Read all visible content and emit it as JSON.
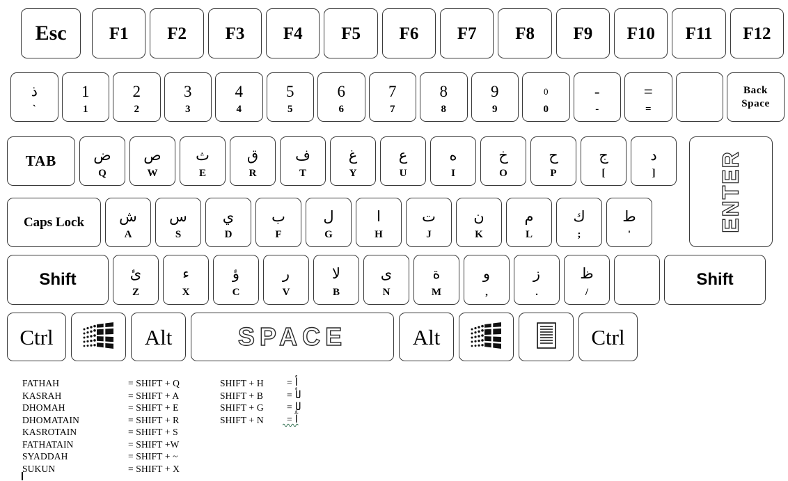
{
  "title": "Arabic Keyboard Layout",
  "rows": {
    "function_row": [
      {
        "label": "Esc",
        "name": "key-esc"
      },
      {
        "label": "F1",
        "name": "key-f1"
      },
      {
        "label": "F2",
        "name": "key-f2"
      },
      {
        "label": "F3",
        "name": "key-f3"
      },
      {
        "label": "F4",
        "name": "key-f4"
      },
      {
        "label": "F5",
        "name": "key-f5"
      },
      {
        "label": "F6",
        "name": "key-f6"
      },
      {
        "label": "F7",
        "name": "key-f7"
      },
      {
        "label": "F8",
        "name": "key-f8"
      },
      {
        "label": "F9",
        "name": "key-f9"
      },
      {
        "label": "F10",
        "name": "key-f10"
      },
      {
        "label": "F11",
        "name": "key-f11"
      },
      {
        "label": "F12",
        "name": "key-f12"
      }
    ],
    "number_row": [
      {
        "arabic": "ذ",
        "latin": "`",
        "name": "key-grave"
      },
      {
        "arabic": "1",
        "latin": "1",
        "name": "key-1"
      },
      {
        "arabic": "2",
        "latin": "2",
        "name": "key-2"
      },
      {
        "arabic": "3",
        "latin": "3",
        "name": "key-3"
      },
      {
        "arabic": "4",
        "latin": "4",
        "name": "key-4"
      },
      {
        "arabic": "5",
        "latin": "5",
        "name": "key-5"
      },
      {
        "arabic": "6",
        "latin": "6",
        "name": "key-6"
      },
      {
        "arabic": "7",
        "latin": "7",
        "name": "key-7"
      },
      {
        "arabic": "8",
        "latin": "8",
        "name": "key-8"
      },
      {
        "arabic": "9",
        "latin": "9",
        "name": "key-9"
      },
      {
        "arabic": "0",
        "latin": "0",
        "name": "key-0"
      },
      {
        "arabic": "-",
        "latin": "-",
        "name": "key-minus"
      },
      {
        "arabic": "=",
        "latin": "=",
        "name": "key-equal"
      },
      {
        "arabic": "",
        "latin": "",
        "name": "key-blank-numrow"
      }
    ],
    "backspace": {
      "line1": "Back",
      "line2": "Space",
      "name": "key-backspace"
    },
    "tab_row": {
      "tab_label": "TAB",
      "keys": [
        {
          "arabic": "ض",
          "latin": "Q",
          "name": "key-q"
        },
        {
          "arabic": "ص",
          "latin": "W",
          "name": "key-w"
        },
        {
          "arabic": "ث",
          "latin": "E",
          "name": "key-e"
        },
        {
          "arabic": "ق",
          "latin": "R",
          "name": "key-r"
        },
        {
          "arabic": "ف",
          "latin": "T",
          "name": "key-t"
        },
        {
          "arabic": "غ",
          "latin": "Y",
          "name": "key-y"
        },
        {
          "arabic": "ع",
          "latin": "U",
          "name": "key-u"
        },
        {
          "arabic": "ه",
          "latin": "I",
          "name": "key-i"
        },
        {
          "arabic": "خ",
          "latin": "O",
          "name": "key-o"
        },
        {
          "arabic": "ح",
          "latin": "P",
          "name": "key-p"
        },
        {
          "arabic": "ج",
          "latin": "[",
          "name": "key-bracketleft"
        },
        {
          "arabic": "د",
          "latin": "]",
          "name": "key-bracketright"
        }
      ]
    },
    "caps_row": {
      "caps_label": "Caps Lock",
      "keys": [
        {
          "arabic": "ش",
          "latin": "A",
          "name": "key-a"
        },
        {
          "arabic": "س",
          "latin": "S",
          "name": "key-s"
        },
        {
          "arabic": "ي",
          "latin": "D",
          "name": "key-d"
        },
        {
          "arabic": "ب",
          "latin": "F",
          "name": "key-f"
        },
        {
          "arabic": "ل",
          "latin": "G",
          "name": "key-g"
        },
        {
          "arabic": "ا",
          "latin": "H",
          "name": "key-h"
        },
        {
          "arabic": "ت",
          "latin": "J",
          "name": "key-j"
        },
        {
          "arabic": "ن",
          "latin": "K",
          "name": "key-k"
        },
        {
          "arabic": "م",
          "latin": "L",
          "name": "key-l"
        },
        {
          "arabic": "ك",
          "latin": ";",
          "name": "key-semicolon"
        },
        {
          "arabic": "ط",
          "latin": "'",
          "name": "key-quote"
        }
      ]
    },
    "shift_row": {
      "shift_left_label": "Shift",
      "shift_right_label": "Shift",
      "keys": [
        {
          "arabic": "ئ",
          "latin": "Z",
          "name": "key-z"
        },
        {
          "arabic": "ء",
          "latin": "X",
          "name": "key-x"
        },
        {
          "arabic": "ؤ",
          "latin": "C",
          "name": "key-c"
        },
        {
          "arabic": "ر",
          "latin": "V",
          "name": "key-v"
        },
        {
          "arabic": "لا",
          "latin": "B",
          "name": "key-b"
        },
        {
          "arabic": "ى",
          "latin": "N",
          "name": "key-n"
        },
        {
          "arabic": "ة",
          "latin": "M",
          "name": "key-m"
        },
        {
          "arabic": "و",
          "latin": ",",
          "name": "key-comma"
        },
        {
          "arabic": "ز",
          "latin": ".",
          "name": "key-period"
        },
        {
          "arabic": "ظ",
          "latin": "/",
          "name": "key-slash"
        },
        {
          "arabic": "",
          "latin": "",
          "name": "key-blank-shiftrow"
        }
      ]
    },
    "bottom_row": {
      "ctrl_left": "Ctrl",
      "win_left": "windows-icon",
      "alt_left": "Alt",
      "space": "SPACE",
      "alt_right": "Alt",
      "win_right": "windows-icon",
      "menu": "menu-icon",
      "ctrl_right": "Ctrl"
    },
    "enter_label": "ENTER"
  },
  "legend": {
    "column1": [
      {
        "name": "FATHAH",
        "value": "= SHIFT + Q"
      },
      {
        "name": "KASRAH",
        "value": "= SHIFT + A"
      },
      {
        "name": "DHOMAH",
        "value": "= SHIFT + E"
      },
      {
        "name": "DHOMATAIN",
        "value": "= SHIFT + R"
      },
      {
        "name": "KASROTAIN",
        "value": "= SHIFT + S"
      },
      {
        "name": "FATHATAIN",
        "value": "= SHIFT +W"
      },
      {
        "name": "SYADDAH",
        "value": "= SHIFT + ~"
      },
      {
        "name": "SUKUN",
        "value": "= SHIFT + X"
      }
    ],
    "column2": [
      {
        "name": "SHIFT + H",
        "eq": "=",
        "glyph": "أ"
      },
      {
        "name": "SHIFT + B",
        "eq": "=",
        "glyph": "لأ"
      },
      {
        "name": "SHIFT + G",
        "eq": "=",
        "glyph": "لإ"
      },
      {
        "name": "SHIFT + N",
        "eq": "=",
        "glyph": "آ"
      }
    ]
  },
  "colors": {
    "key_border": "#3a3a3a",
    "key_face": "#ffffff",
    "text": "#000000",
    "background": "#ffffff"
  }
}
